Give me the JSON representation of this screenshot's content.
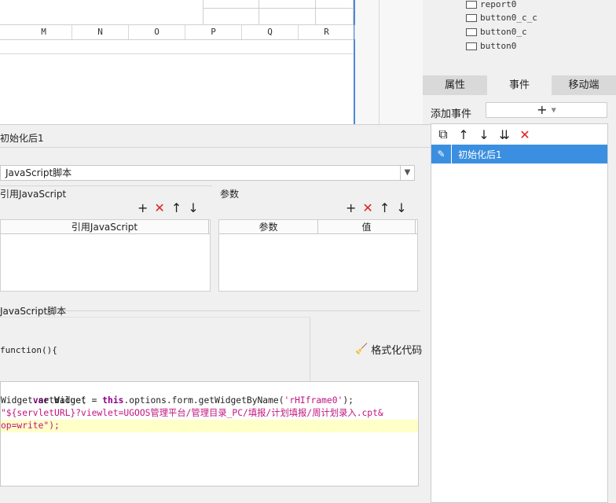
{
  "sheet": {
    "columns": [
      "M",
      "N",
      "O",
      "P",
      "Q",
      "R"
    ]
  },
  "tree": {
    "items": [
      "report0",
      "button0_c_c",
      "button0_c",
      "button0"
    ]
  },
  "tabs": [
    "属性",
    "事件",
    "移动端"
  ],
  "add_event": {
    "label": "添加事件",
    "button": "+"
  },
  "event_list": {
    "selected": "初始化后1"
  },
  "editor": {
    "event_title": "初始化后1",
    "type_value": "JavaScript脚本",
    "ref_section_label": "引用JavaScript",
    "ref_table_header": "引用JavaScript",
    "params_section_label": "参数",
    "params_headers": [
      "参数",
      "值"
    ],
    "script_section_label": "JavaScript脚本",
    "function_signature": "function(){",
    "format_button": "格式化代码",
    "code_lines": [
      "var Widget = this.options.form.getWidgetByName('rHIframe0');",
      "Widget.setValue(",
      "\"${servletURL}?viewlet=UGOOS管理平台/管理目录_PC/填报/计划填报/周计划录入.cpt&",
      "op=write\");"
    ]
  },
  "colors": {
    "accent": "#3a8fe0",
    "delete_red": "#e02020",
    "highlight_line": "#ffffc8"
  }
}
